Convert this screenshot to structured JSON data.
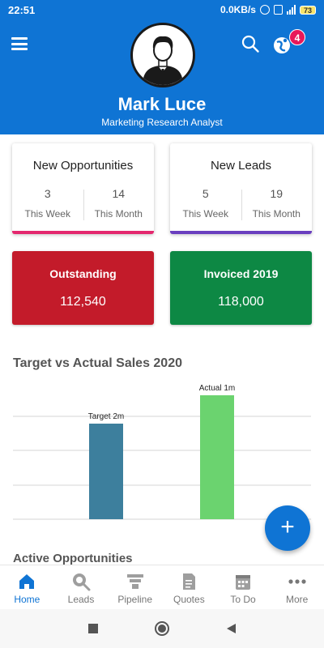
{
  "status_bar": {
    "time": "22:51",
    "network_speed": "0.0KB/s",
    "battery": "73"
  },
  "header": {
    "user_name": "Mark Luce",
    "user_title": "Marketing Research Analyst",
    "notification_count": "4",
    "color": "#0f74d4"
  },
  "stats": [
    {
      "title": "New Opportunities",
      "week_value": "3",
      "week_label": "This Week",
      "month_value": "14",
      "month_label": "This Month",
      "accent": "#e4286e"
    },
    {
      "title": "New Leads",
      "week_value": "5",
      "week_label": "This Week",
      "month_value": "19",
      "month_label": "This Month",
      "accent": "#6a3fbf"
    }
  ],
  "money": [
    {
      "title": "Outstanding",
      "value": "112,540",
      "color": "#c31b2a"
    },
    {
      "title": "Invoiced 2019",
      "value": "118,000",
      "color": "#0d8844"
    }
  ],
  "chart_title": "Target vs Actual Sales 2020",
  "chart_data": {
    "type": "bar",
    "categories": [
      "Target",
      "Actual"
    ],
    "values": [
      2,
      1
    ],
    "data_labels": [
      "Target 2m",
      "Actual 1m"
    ],
    "colors": [
      "#3d7f9d",
      "#6bd36f"
    ],
    "grid": true
  },
  "active_title": "Active Opportunities",
  "nav": [
    {
      "label": "Home",
      "icon": "home-icon",
      "active": true
    },
    {
      "label": "Leads",
      "icon": "leads-icon",
      "active": false
    },
    {
      "label": "Pipeline",
      "icon": "pipeline-icon",
      "active": false
    },
    {
      "label": "Quotes",
      "icon": "quotes-icon",
      "active": false
    },
    {
      "label": "To Do",
      "icon": "calendar-icon",
      "active": false
    },
    {
      "label": "More",
      "icon": "more-icon",
      "active": false
    }
  ]
}
